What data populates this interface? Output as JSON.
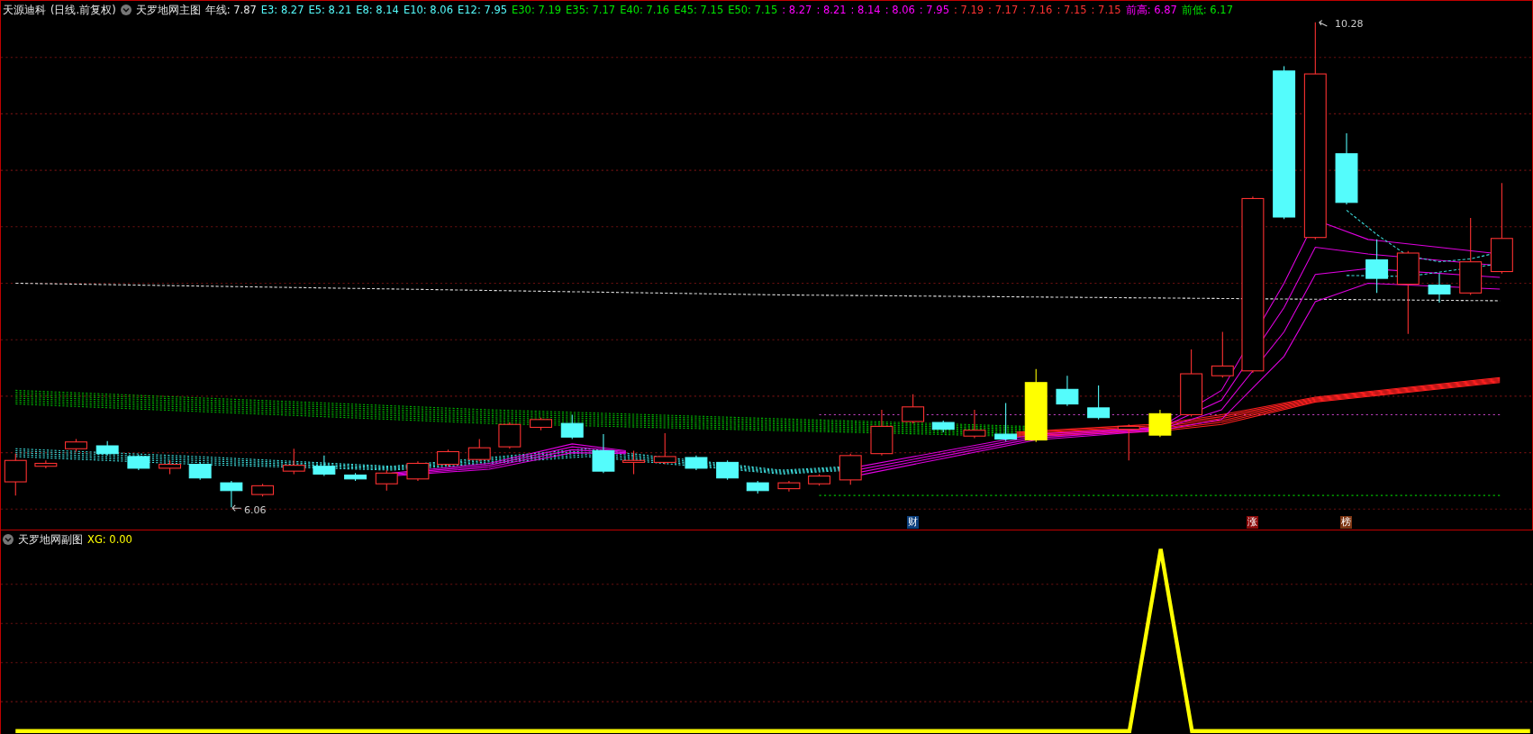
{
  "header": {
    "stock": "天源迪科",
    "period": "(日线.前复权)",
    "indicator": "天罗地网主图",
    "readouts": [
      {
        "text": "年线: 7.87",
        "color": "#e6e6e6"
      },
      {
        "text": "E3: 8.27",
        "color": "#54fcfc"
      },
      {
        "text": "E5: 8.21",
        "color": "#54fcfc"
      },
      {
        "text": "E8: 8.14",
        "color": "#54fcfc"
      },
      {
        "text": "E10: 8.06",
        "color": "#54fcfc"
      },
      {
        "text": "E12: 7.95",
        "color": "#54fcfc"
      },
      {
        "text": "E30: 7.19",
        "color": "#00e600"
      },
      {
        "text": "E35: 7.17",
        "color": "#00e600"
      },
      {
        "text": "E40: 7.16",
        "color": "#00e600"
      },
      {
        "text": "E45: 7.15",
        "color": "#00e600"
      },
      {
        "text": "E50: 7.15",
        "color": "#00e600"
      },
      {
        "text": ": 8.27",
        "color": "#ff00ff"
      },
      {
        "text": ": 8.21",
        "color": "#ff00ff"
      },
      {
        "text": ": 8.14",
        "color": "#ff00ff"
      },
      {
        "text": ": 8.06",
        "color": "#ff00ff"
      },
      {
        "text": ": 7.95",
        "color": "#ff00ff"
      },
      {
        "text": ": 7.19",
        "color": "#ff3232"
      },
      {
        "text": ": 7.17",
        "color": "#ff3232"
      },
      {
        "text": ": 7.16",
        "color": "#ff3232"
      },
      {
        "text": ": 7.15",
        "color": "#ff3232"
      },
      {
        "text": ": 7.15",
        "color": "#ff3232"
      },
      {
        "text": "前高: 6.87",
        "color": "#ff00ff"
      },
      {
        "text": "前低: 6.17",
        "color": "#00e600"
      }
    ]
  },
  "main_chart": {
    "high_label": "10.28",
    "low_label": "6.06",
    "markers": [
      {
        "text": "财",
        "color": "#0b3f7d"
      },
      {
        "text": "涨",
        "color": "#8c0a0a"
      },
      {
        "text": "榜",
        "color": "#7d3512"
      }
    ]
  },
  "sub_chart": {
    "indicator": "天罗地网副图",
    "readout": {
      "text": "XG: 0.00",
      "color": "#ffff00"
    }
  }
}
